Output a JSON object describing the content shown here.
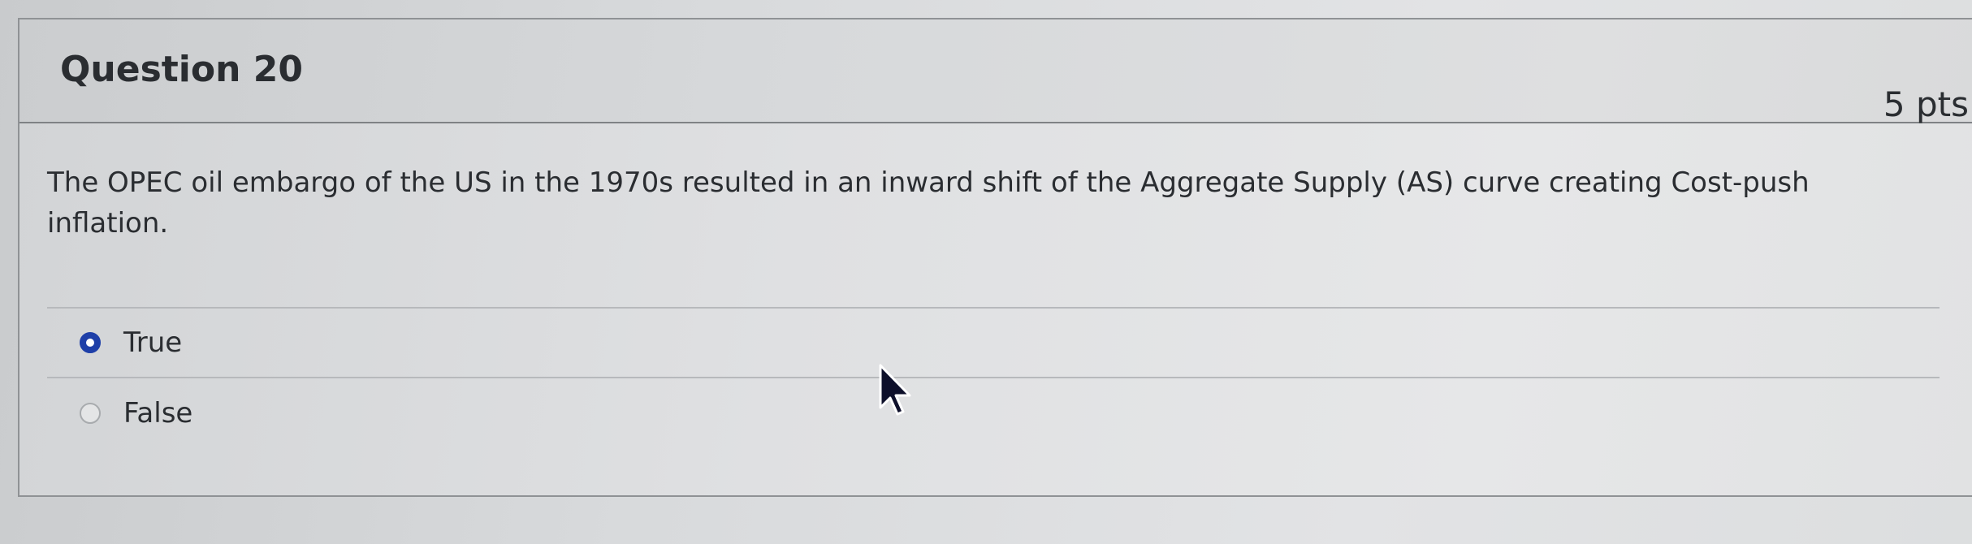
{
  "question": {
    "title": "Question 20",
    "points": "5 pts",
    "text": "The OPEC oil embargo of the US in the 1970s resulted in an inward shift of the Aggregate Supply (AS) curve creating Cost-push inflation."
  },
  "answers": [
    {
      "label": "True",
      "selected": true
    },
    {
      "label": "False",
      "selected": false
    }
  ],
  "colors": {
    "radio_selected": "#1e3fa8",
    "text": "#2a2d31"
  },
  "icons": {
    "cursor": "mouse-pointer-icon"
  }
}
